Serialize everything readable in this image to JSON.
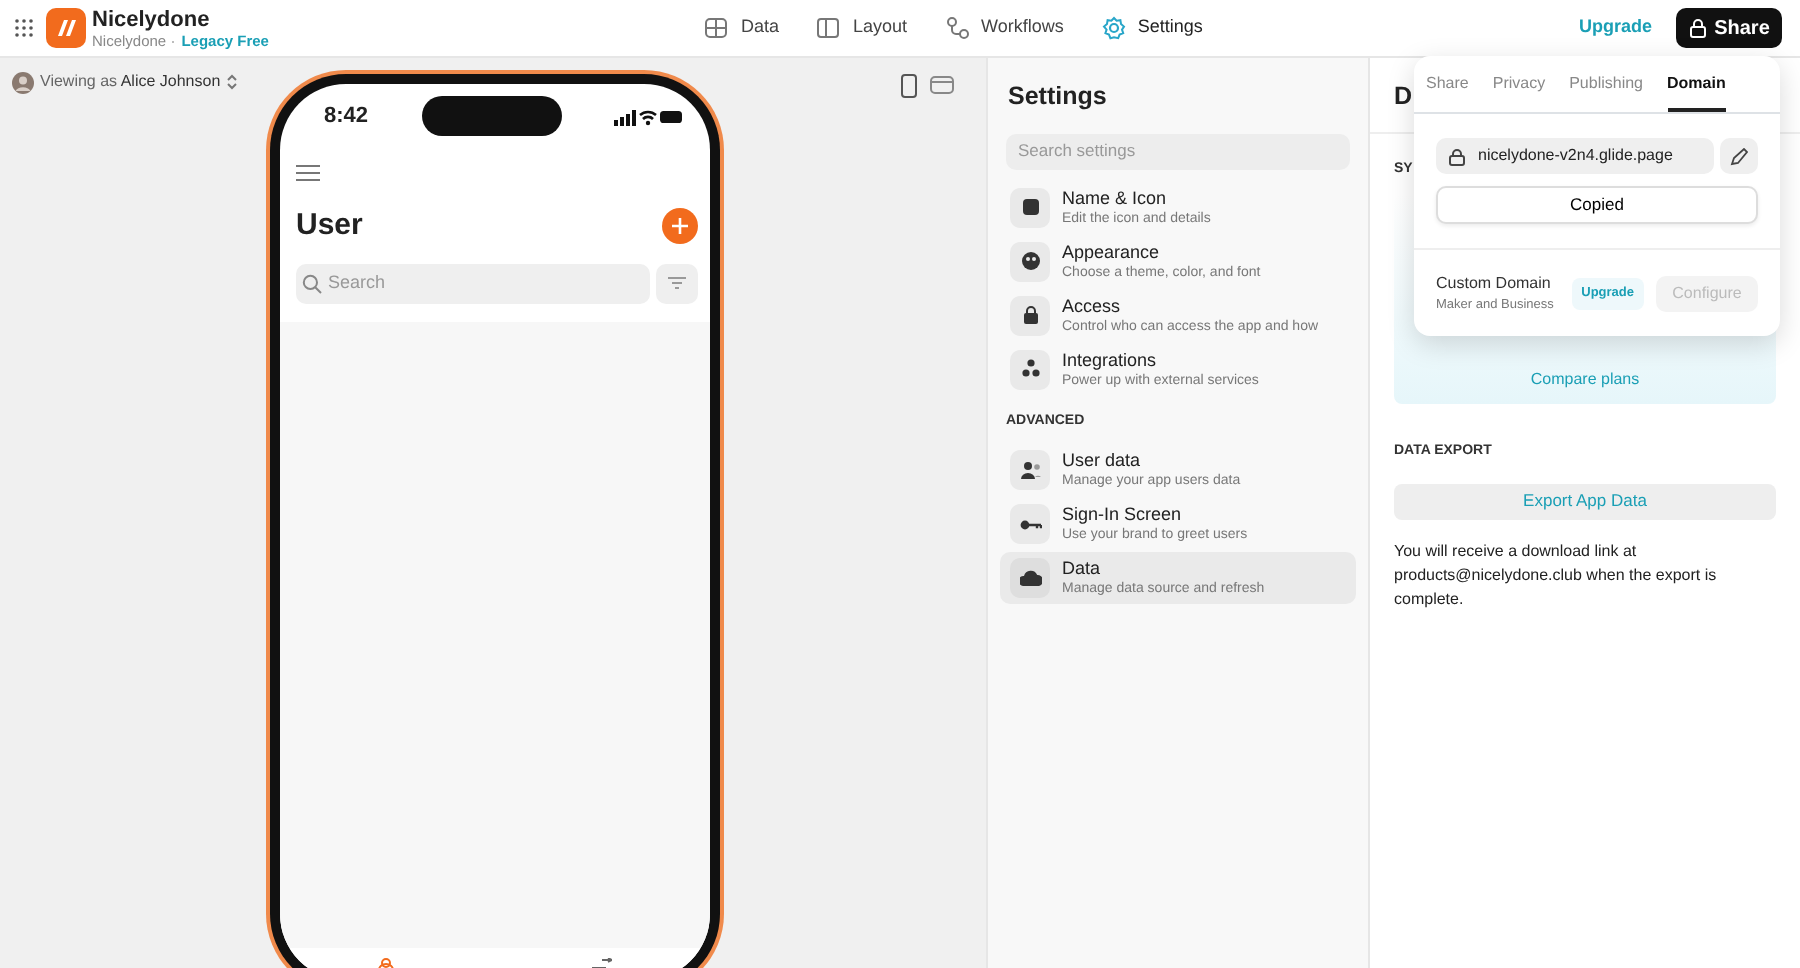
{
  "app": {
    "name": "Nicelydone",
    "workspace": "Nicelydone ·",
    "plan": "Legacy Free"
  },
  "nav_tabs": [
    {
      "label": "Data",
      "selected": false
    },
    {
      "label": "Layout",
      "selected": false
    },
    {
      "label": "Workflows",
      "selected": false
    },
    {
      "label": "Settings",
      "selected": true
    }
  ],
  "upgrade_link": "Upgrade",
  "share_button": "Share",
  "preview": {
    "viewing_as": "Viewing as **Alice Johnson**",
    "phone": {
      "time": "8:42",
      "title": "User",
      "search_placeholder": "Search"
    }
  },
  "settings": {
    "title": "Settings",
    "search_placeholder": "Search settings",
    "groups": [
      {
        "items": [
          {
            "title": "Name & Icon",
            "subtitle": "Edit the icon and details",
            "selected": false
          },
          {
            "title": "Appearance",
            "subtitle": "Choose a theme, color, and font",
            "selected": false
          },
          {
            "title": "Access",
            "subtitle": "Control who can access the app and how",
            "selected": false
          },
          {
            "title": "Integrations",
            "subtitle": "Power up with external services",
            "selected": false
          }
        ]
      },
      {
        "heading": "ADVANCED",
        "items": [
          {
            "title": "User data",
            "subtitle": "Manage your app users data",
            "selected": false
          },
          {
            "title": "Sign-In Screen",
            "subtitle": "Use your brand to greet users",
            "selected": false
          },
          {
            "title": "Data",
            "subtitle": "Manage data source and refresh",
            "selected": true
          }
        ]
      }
    ]
  },
  "data_panel": {
    "title": "D",
    "section_label": "SY",
    "compare_plans": "Compare plans",
    "export_heading": "DATA EXPORT",
    "export_button": "Export App Data",
    "export_note": "You will receive a download link at products@nicelydone.club when the export is complete."
  },
  "share_popover": {
    "tabs": [
      {
        "label": "Share",
        "selected": false
      },
      {
        "label": "Privacy",
        "selected": false
      },
      {
        "label": "Publishing",
        "selected": false
      },
      {
        "label": "Domain",
        "selected": true
      }
    ],
    "domain": "nicelydone-v2n4.glide.page",
    "copy_button": "Copied",
    "custom_domain": {
      "title": "Custom Domain",
      "subtitle": "Maker and Business",
      "upgrade": "Upgrade",
      "configure": "Configure",
      "configure_disabled": true
    }
  }
}
